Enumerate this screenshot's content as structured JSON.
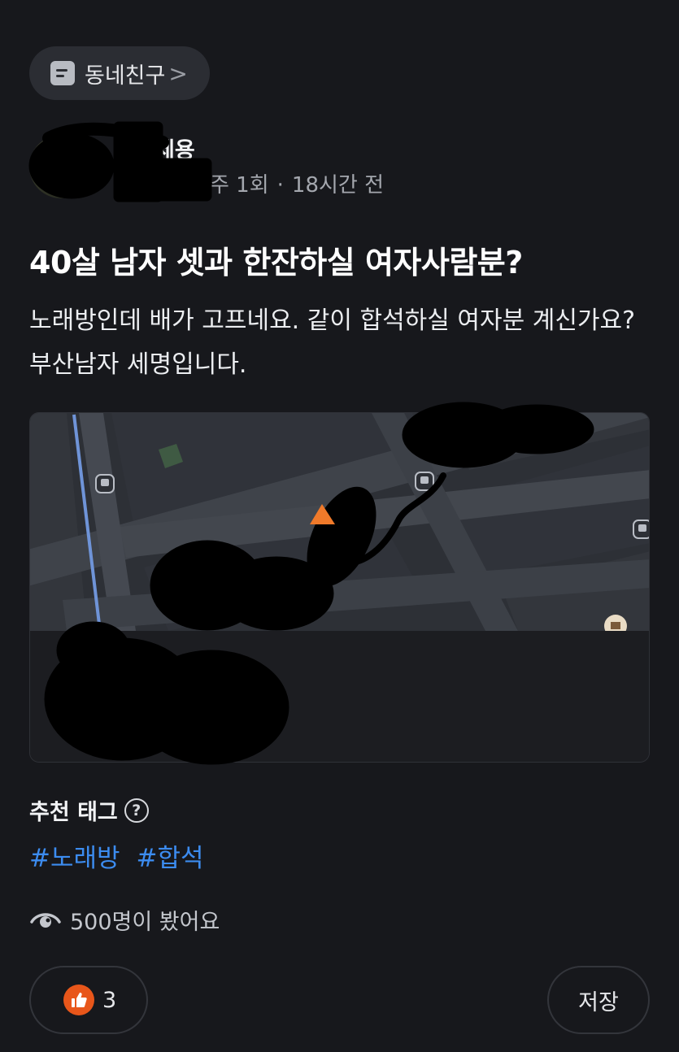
{
  "category_chip": {
    "icon": "board-icon",
    "label": "동네친구",
    "chevron": ">"
  },
  "author": {
    "name_visible": "세용",
    "meta_visible": "주 1회",
    "time": "18시간 전",
    "separator": "·"
  },
  "post": {
    "title": "40살 남자 셋과 한잔하실 여자사람분?",
    "body": "노래방인데 배가 고프네요. 같이 합석하실 여자분 계신가요? 부산남자 세명입니다."
  },
  "map": {
    "bus_icon": "bus-stop-icon",
    "pin_icon": "home-pin-icon"
  },
  "tags": {
    "title": "추천 태그",
    "help": "?",
    "items": [
      "#노래방",
      "#합석"
    ]
  },
  "views": {
    "icon": "eye-icon",
    "text": "500명이 봤어요"
  },
  "actions": {
    "like_count": "3",
    "like_icon": "thumbs-up-icon",
    "save_label": "저장"
  },
  "colors": {
    "background": "#17181c",
    "tag_blue": "#3c8cf0",
    "like_orange": "#e8561a",
    "chip_bg": "#2b2d33"
  }
}
